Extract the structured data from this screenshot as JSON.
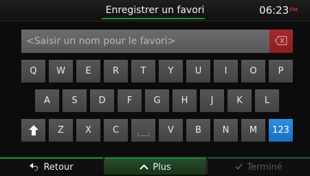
{
  "header": {
    "title": "Enregistrer un favori",
    "time": "06:23",
    "ampm": "PM"
  },
  "input": {
    "placeholder": "<Saisir un nom pour le favori>"
  },
  "clear_icon": "backspace-icon",
  "keyboard": {
    "row1": [
      "Q",
      "W",
      "E",
      "R",
      "T",
      "Y",
      "U",
      "I",
      "O",
      "P"
    ],
    "row2": [
      "A",
      "S",
      "D",
      "F",
      "G",
      "H",
      "J",
      "K",
      "L"
    ],
    "row3": [
      "Z",
      "X",
      "C",
      "V",
      "B",
      "N",
      "M"
    ],
    "numbers_label": "123",
    "shift_icon": "shift-arrow-icon"
  },
  "footer": {
    "back_label": "Retour",
    "more_label": "Plus",
    "done_label": "Terminé"
  },
  "colors": {
    "accent_green": "#1c8a34",
    "blue_key": "#2d8fdf",
    "clear_red": "#a52a2a"
  }
}
